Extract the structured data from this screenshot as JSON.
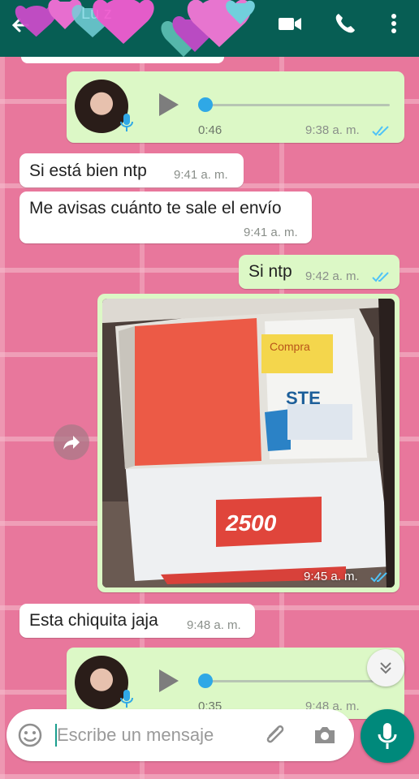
{
  "header": {
    "contact_name": "Lu        z",
    "icons": [
      "back-arrow-icon",
      "video-call-icon",
      "phone-icon",
      "more-options-icon"
    ]
  },
  "messages": [
    {
      "type": "voice",
      "direction": "out",
      "duration": "0:46",
      "time": "9:38 a. m.",
      "status": "read",
      "progress": 0.0
    },
    {
      "type": "text",
      "direction": "in",
      "text": "Si está bien ntp",
      "time": "9:41 a. m."
    },
    {
      "type": "text",
      "direction": "in",
      "text": "Me avisas cuánto te sale el envío",
      "time": "9:41 a. m."
    },
    {
      "type": "text",
      "direction": "out",
      "text": "Si ntp",
      "time": "9:42 a. m.",
      "status": "read"
    },
    {
      "type": "image",
      "direction": "out",
      "time": "9:45 a. m.",
      "status": "read",
      "photo_text": {
        "box_model": "2500",
        "box_brand": "STE",
        "label": "Compra"
      }
    },
    {
      "type": "text",
      "direction": "in",
      "text": "Esta chiquita jaja",
      "time": "9:48 a. m."
    },
    {
      "type": "voice",
      "direction": "out",
      "duration": "0:35",
      "time": "9:48 a. m.",
      "status": "read",
      "progress": 0.0
    }
  ],
  "input": {
    "placeholder": "Escribe un mensaje",
    "icons": [
      "emoji-icon",
      "attach-icon",
      "camera-icon",
      "mic-icon"
    ]
  },
  "colors": {
    "header": "#075e54",
    "outgoing_bubble": "#dcf8c6",
    "incoming_bubble": "#ffffff",
    "accent": "#00897b",
    "read_ticks": "#4fc3f7",
    "wallpaper": "#e8779c"
  }
}
